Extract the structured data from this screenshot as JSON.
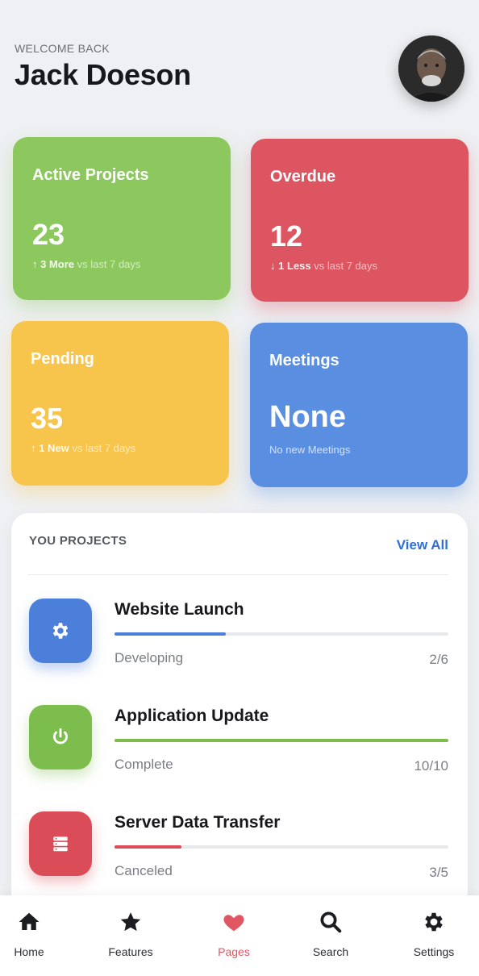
{
  "header": {
    "welcome": "WELCOME BACK",
    "name": "Jack Doeson"
  },
  "stats": [
    {
      "title": "Active Projects",
      "value": "23",
      "arrow": "↑",
      "delta": "3 More",
      "suffix": "vs last 7 days",
      "color": "#8cc85e"
    },
    {
      "title": "Overdue",
      "value": "12",
      "arrow": "↓",
      "delta": "1 Less",
      "suffix": "vs last 7 days",
      "color": "#dd5560"
    },
    {
      "title": "Pending",
      "value": "35",
      "arrow": "↑",
      "delta": "1 New",
      "suffix": "vs last 7 days",
      "color": "#f8c54c"
    },
    {
      "title": "Meetings",
      "value": "None",
      "note": "No new Meetings",
      "color": "#5a8ee0"
    }
  ],
  "projects": {
    "title": "YOU PROJECTS",
    "view_all": "View All",
    "items": [
      {
        "name": "Website Launch",
        "status": "Developing",
        "count": "2/6",
        "progress": 0.333,
        "color": "#4b7fd9",
        "icon": "gear-icon"
      },
      {
        "name": "Application Update",
        "status": "Complete",
        "count": "10/10",
        "progress": 1.0,
        "color": "#7dbd4e",
        "icon": "power-icon"
      },
      {
        "name": "Server Data Transfer",
        "status": "Canceled",
        "count": "3/5",
        "progress": 0.2,
        "color": "#d94c58",
        "icon": "server-icon"
      }
    ]
  },
  "nav": {
    "items": [
      {
        "label": "Home",
        "icon": "home-icon",
        "active": false
      },
      {
        "label": "Features",
        "icon": "star-icon",
        "active": false
      },
      {
        "label": "Pages",
        "icon": "heart-icon",
        "active": true
      },
      {
        "label": "Search",
        "icon": "search-icon",
        "active": false
      },
      {
        "label": "Settings",
        "icon": "gear-icon",
        "active": false
      }
    ]
  },
  "colors": {
    "accent": "#2f6fd6",
    "active_nav": "#e05763"
  }
}
